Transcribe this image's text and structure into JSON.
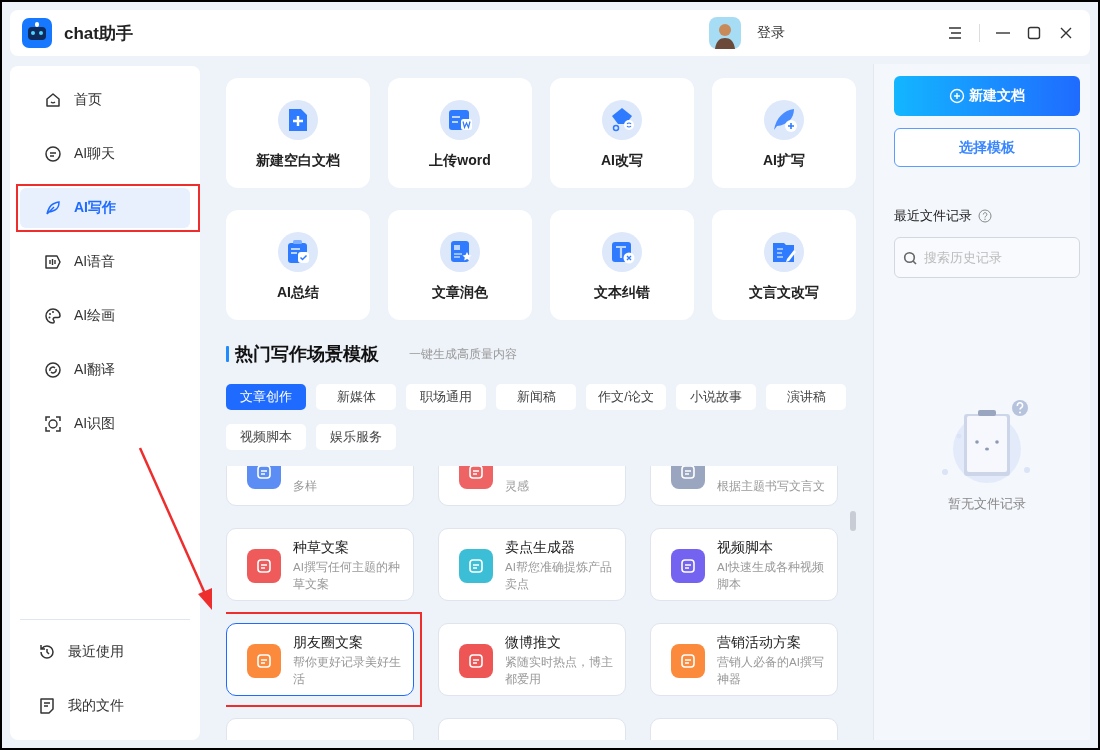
{
  "window": {
    "title": "chat助手",
    "login": "登录",
    "annotation_arrow": true
  },
  "sidebar": {
    "items": [
      {
        "label": "首页",
        "selected": false,
        "annotated": false
      },
      {
        "label": "AI聊天",
        "selected": false,
        "annotated": false
      },
      {
        "label": "AI写作",
        "selected": true,
        "annotated": true
      },
      {
        "label": "AI语音",
        "selected": false,
        "annotated": false
      },
      {
        "label": "AI绘画",
        "selected": false,
        "annotated": false
      },
      {
        "label": "AI翻译",
        "selected": false,
        "annotated": false
      },
      {
        "label": "AI识图",
        "selected": false,
        "annotated": false
      }
    ],
    "bottom_items": [
      {
        "label": "最近使用"
      },
      {
        "label": "我的文件"
      }
    ]
  },
  "tools": [
    {
      "label": "新建空白文档"
    },
    {
      "label": "上传word"
    },
    {
      "label": "AI改写"
    },
    {
      "label": "AI扩写"
    },
    {
      "label": "AI总结"
    },
    {
      "label": "文章润色"
    },
    {
      "label": "文本纠错"
    },
    {
      "label": "文言文改写"
    }
  ],
  "templates": {
    "title": "热门写作场景模板",
    "subtitle": "一键生成高质量内容",
    "tabs": [
      {
        "label": "文章创作",
        "selected": true
      },
      {
        "label": "新媒体",
        "selected": false
      },
      {
        "label": "职场通用",
        "selected": false
      },
      {
        "label": "新闻稿",
        "selected": false
      },
      {
        "label": "作文/论文",
        "selected": false
      },
      {
        "label": "小说故事",
        "selected": false
      },
      {
        "label": "演讲稿",
        "selected": false
      },
      {
        "label": "视频脚本",
        "selected": false
      },
      {
        "label": "娱乐服务",
        "selected": false
      }
    ],
    "cards": [
      {
        "kind": "cut",
        "description": "多样",
        "color": "#5b8df5",
        "annotated": false
      },
      {
        "kind": "cut",
        "description": "灵感",
        "color": "#ee6363",
        "annotated": false
      },
      {
        "kind": "cut",
        "description": "根据主题书写文言文",
        "color": "#9aa6c0",
        "annotated": false
      },
      {
        "kind": "full",
        "title": "种草文案",
        "description": "AI撰写任何主题的种草文案",
        "color": "#ef5a5a",
        "annotated": false
      },
      {
        "kind": "full",
        "title": "卖点生成器",
        "description": "AI帮您准确提炼产品卖点",
        "color": "#3cbfd6",
        "annotated": false
      },
      {
        "kind": "full",
        "title": "视频脚本",
        "description": "AI快速生成各种视频脚本",
        "color": "#7462f0",
        "annotated": false
      },
      {
        "kind": "full",
        "title": "朋友圈文案",
        "description": "帮你更好记录美好生活",
        "color": "#fb8a3c",
        "annotated": true
      },
      {
        "kind": "full",
        "title": "微博推文",
        "description": "紧随实时热点，博主都爱用",
        "color": "#ee5555",
        "annotated": false
      },
      {
        "kind": "full",
        "title": "营销活动方案",
        "description": "营销人必备的AI撰写神器",
        "color": "#fb8a3c",
        "annotated": false
      },
      {
        "kind": "edge"
      },
      {
        "kind": "edge"
      },
      {
        "kind": "edge"
      }
    ]
  },
  "right_panel": {
    "new_button": "新建文档",
    "template_button": "选择模板",
    "recent_title": "最近文件记录",
    "search_placeholder": "搜索历史记录",
    "empty_text": "暂无文件记录"
  }
}
